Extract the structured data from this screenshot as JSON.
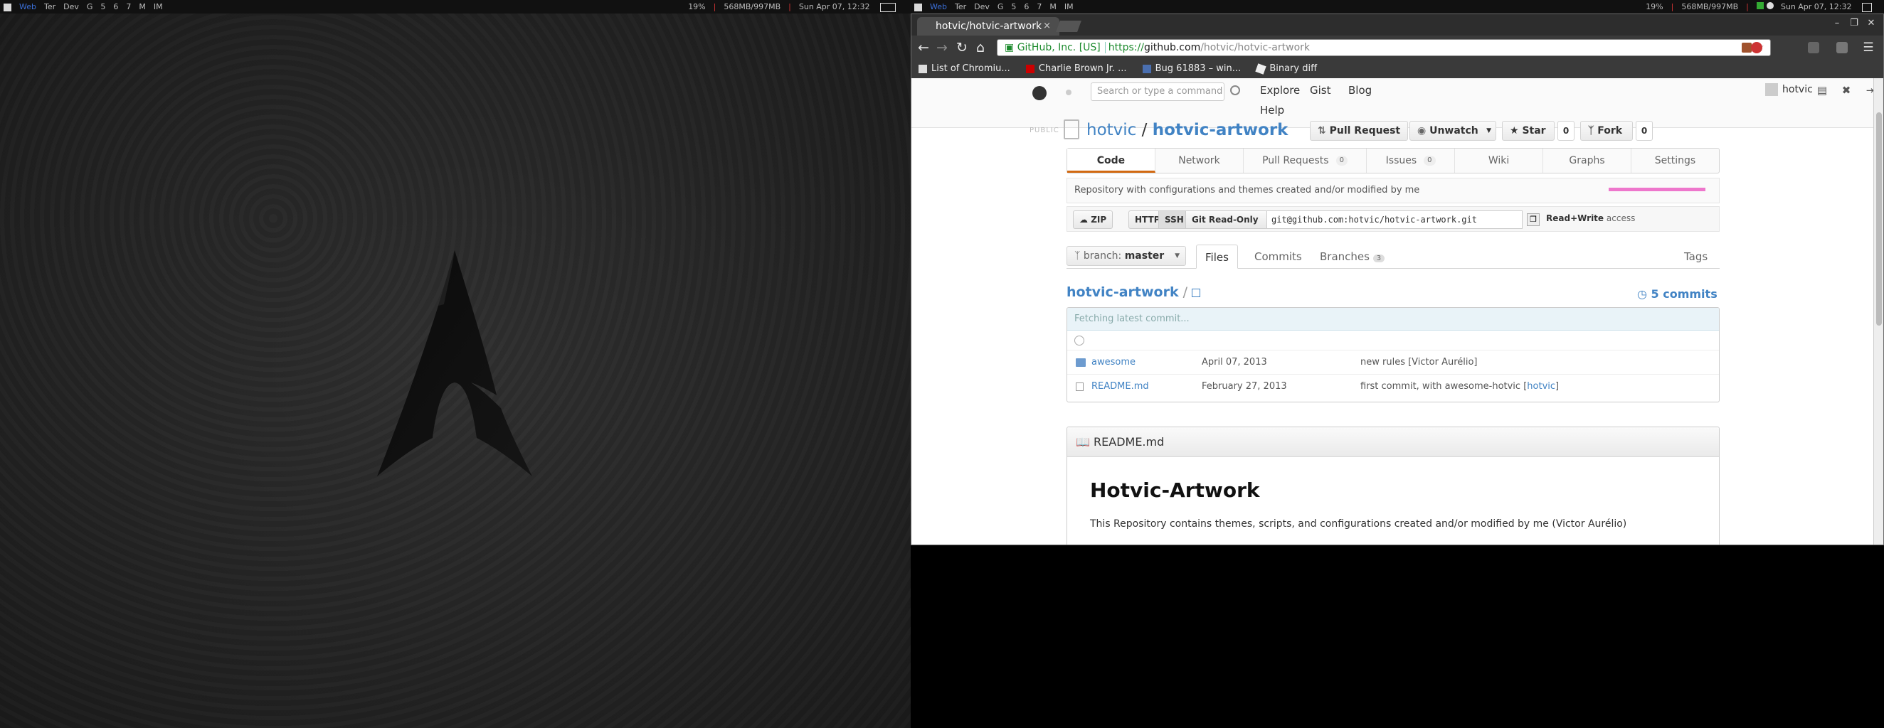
{
  "left_panel": {
    "workspaces": [
      "Web",
      "Ter",
      "Dev",
      "G",
      "5",
      "6",
      "7",
      "M",
      "IM"
    ],
    "active_workspace": "Web",
    "status": {
      "battery": "19%",
      "memory": "568MB/997MB",
      "clock": "Sun Apr 07, 12:32"
    }
  },
  "right_panel": {
    "workspaces": [
      "Web",
      "Ter",
      "Dev",
      "G",
      "5",
      "6",
      "7",
      "M",
      "IM"
    ],
    "status": {
      "battery": "19%",
      "memory": "568MB/997MB",
      "clock": "Sun Apr 07, 12:32"
    }
  },
  "browser": {
    "tab_title": "hotvic/hotvic-artwork",
    "tab_close": "×",
    "url_ev": "GitHub, Inc. [US]",
    "url_scheme": "https://",
    "url_host": "github.com",
    "url_path": "/hotvic/hotvic-artwork",
    "bookmarks": [
      "List of Chromiu...",
      "Charlie Brown Jr. ...",
      "Bug 61883 – win...",
      "Binary diff"
    ]
  },
  "github": {
    "search_placeholder": "Search or type a command",
    "nav": [
      "Explore",
      "Gist",
      "Blog",
      "Help"
    ],
    "username": "hotvic",
    "public_label": "PUBLIC",
    "repo_owner": "hotvic",
    "repo_sep": " / ",
    "repo_name": "hotvic-artwork",
    "pull_request": "Pull Request",
    "unwatch": "Unwatch",
    "star": "Star",
    "star_count": "0",
    "fork": "Fork",
    "fork_count": "0",
    "tabs": [
      {
        "label": "Code",
        "badge": ""
      },
      {
        "label": "Network",
        "badge": ""
      },
      {
        "label": "Pull Requests",
        "badge": "0"
      },
      {
        "label": "Issues",
        "badge": "0"
      },
      {
        "label": "Wiki",
        "badge": ""
      },
      {
        "label": "Graphs",
        "badge": ""
      },
      {
        "label": "Settings",
        "badge": ""
      }
    ],
    "description": "Repository with configurations and themes created and/or modified by me",
    "zip": "ZIP",
    "http": "HTTP",
    "ssh": "SSH",
    "git_readonly": "Git Read-Only",
    "clone_url": "git@github.com:hotvic/hotvic-artwork.git",
    "access_strong": "Read+Write",
    "access_text": "access",
    "branch_label": "branch:",
    "branch_name": "master",
    "subtabs": {
      "files": "Files",
      "commits": "Commits",
      "branches": "Branches",
      "branches_count": "3",
      "tags": "Tags"
    },
    "breadcrumb": "hotvic-artwork",
    "commits_count": "5 commits",
    "fetching": "Fetching latest commit...",
    "files": [
      {
        "name": "awesome",
        "date": "April 07, 2013",
        "message": "new rules [Victor Aurélio]",
        "author_link": ""
      },
      {
        "name": "README.md",
        "date": "February 27, 2013",
        "message": "first commit, with awesome-hotvic [",
        "author_link": "hotvic"
      }
    ],
    "readme_file": "README.md",
    "readme_h1": "Hotvic-Artwork",
    "readme_p": "This Repository contains themes, scripts, and configurations created and/or modified by me (Victor Aurélio)"
  }
}
